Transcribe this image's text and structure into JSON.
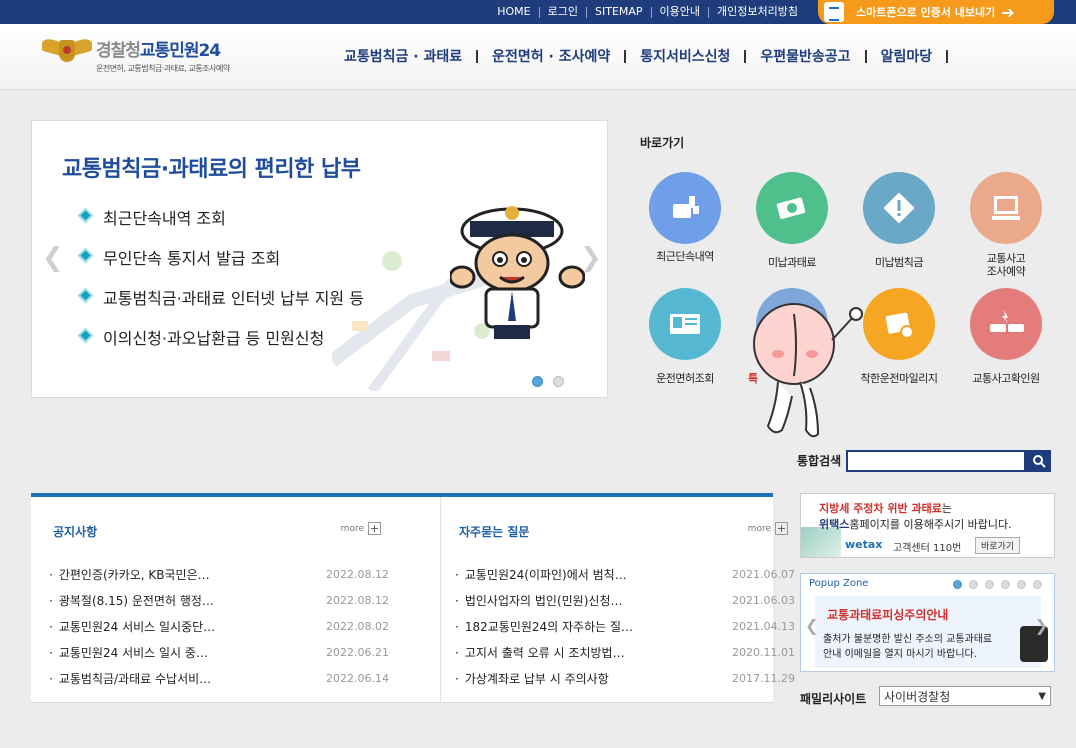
{
  "topbar": {
    "links": [
      "HOME",
      "로그인",
      "SITEMAP",
      "이용안내",
      "개인정보처리방침"
    ],
    "smart_button": "스마트폰으로 인증서 내보내기"
  },
  "logo": {
    "title_a": "경찰청",
    "title_b": "교통민원24",
    "subtitle": "운전면허, 교통범칙금·과태료, 교통조사예약"
  },
  "gnb": [
    "교통범칙금 · 과태료",
    "운전면허 · 조사예약",
    "통지서비스신청",
    "우편물반송공고",
    "알림마당"
  ],
  "banner": {
    "title": "교통범칙금·과태료의 편리한 납부",
    "items": [
      "최근단속내역 조회",
      "무인단속 통지서 발급 조회",
      "교통범칙금·과태료 인터넷 납부 지원 등",
      "이의신청·과오납환급 등 민원신청"
    ],
    "active_slide": 1,
    "slide_count": 2
  },
  "quick": {
    "title": "바로가기",
    "items": [
      {
        "label": "최근단속내역",
        "color": "#6f9fe8",
        "icon": "camera-icon"
      },
      {
        "label": "미납과태료",
        "color": "#4fbf8b",
        "icon": "money-icon"
      },
      {
        "label": "미납범칙금",
        "color": "#6aa8c8",
        "icon": "warning-sign-icon"
      },
      {
        "label": "교통사고\n조사예약",
        "color": "#e9a98a",
        "icon": "computer-icon"
      },
      {
        "label": "운전면허조회",
        "color": "#55b7d2",
        "icon": "license-card-icon"
      },
      {
        "label": "특",
        "color": "#7fa7d9",
        "icon": "document-icon"
      },
      {
        "label": "착한운전마일리지",
        "color": "#f5a623",
        "icon": "mileage-icon"
      },
      {
        "label": "교통사고확인원",
        "color": "#e57c7c",
        "icon": "car-accident-icon"
      }
    ]
  },
  "search": {
    "label": "통합검색",
    "value": ""
  },
  "notice": {
    "title": "공지사항",
    "more": "more",
    "items": [
      {
        "t": "간편인증(카카오, KB국민은…",
        "d": "2022.08.12"
      },
      {
        "t": "광복절(8.15) 운전면허 행정…",
        "d": "2022.08.12"
      },
      {
        "t": "교통민원24 서비스 일시중단…",
        "d": "2022.08.02"
      },
      {
        "t": "교통민원24 서비스 일시 중…",
        "d": "2022.06.21"
      },
      {
        "t": "교통범칙금/과태료 수납서비…",
        "d": "2022.06.14"
      }
    ]
  },
  "faq": {
    "title": "자주묻는 질문",
    "more": "more",
    "items": [
      {
        "t": "교통민원24(이파인)에서 범칙…",
        "d": "2021.06.07"
      },
      {
        "t": "법인사업자의 법인(민원)신청…",
        "d": "2021.06.03"
      },
      {
        "t": "182교통민원24의 자주하는 질…",
        "d": "2021.04.13"
      },
      {
        "t": "고지서 출력 오류 시 조치방법…",
        "d": "2020.11.01"
      },
      {
        "t": "가상계좌로 납부 시 주의사항",
        "d": "2017.11.29"
      }
    ]
  },
  "wetax": {
    "line1_red": "지방세 주정차 위반 과태료",
    "line1_rest": "는",
    "line2_bold": "위택스",
    "line2_rest": "홈페이지를 이용해주시기 바랍니다.",
    "logo": "wetax",
    "center": "고객센터 110번",
    "go": "바로가기"
  },
  "popup": {
    "zone": "Popup Zone",
    "title": "교통과태료피싱주의안내",
    "desc1": "출처가 불분명한 발신 주소의 교통과태료",
    "desc2": "안내 이메일을 열지 마시기 바랍니다.",
    "active_dot": 1,
    "dot_count": 6
  },
  "family": {
    "label": "패밀리사이트",
    "selected": "사이버경찰청"
  }
}
